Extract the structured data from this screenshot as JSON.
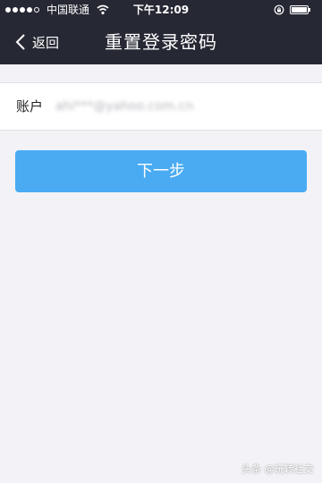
{
  "status_bar": {
    "carrier": "中国联通",
    "time": "下午12:09"
  },
  "nav": {
    "back_label": "返回",
    "title": "重置登录密码"
  },
  "form": {
    "account_label": "账户",
    "account_value": "ahi***@yahoo.com.cn"
  },
  "actions": {
    "next_label": "下一步"
  },
  "watermark": {
    "text": "头条 @玩转社交"
  },
  "colors": {
    "header_bg": "#262834",
    "page_bg": "#f2f2f7",
    "button_bg": "#4aabf3"
  }
}
